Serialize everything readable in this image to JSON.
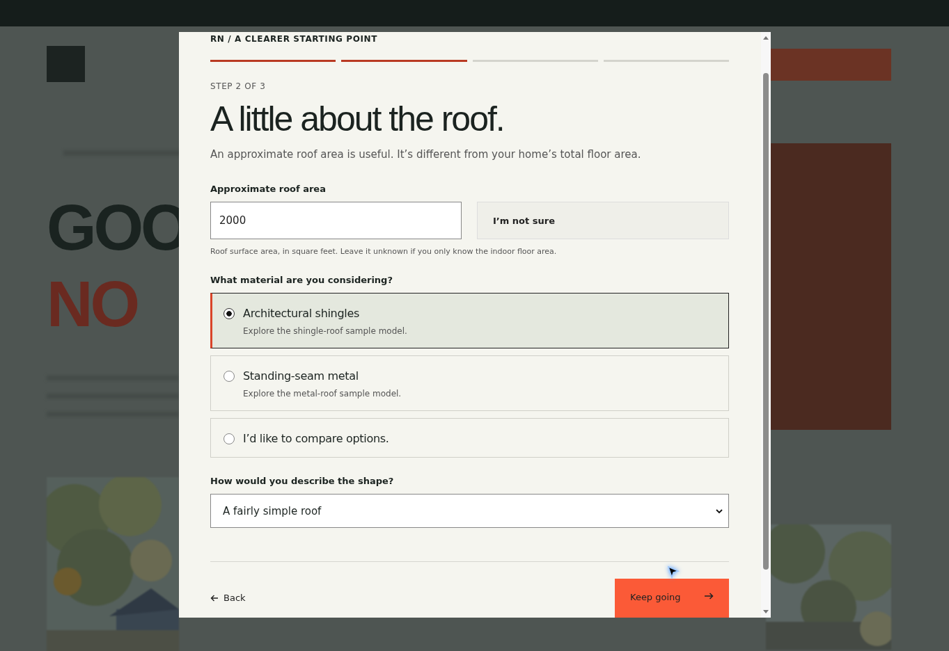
{
  "background": {
    "headline": [
      {
        "text": "GOO",
        "kind": "dark"
      },
      {
        "text": "NO",
        "kind": "accent"
      }
    ]
  },
  "modal": {
    "eyebrow": "RN / A CLEARER STARTING POINT",
    "progress": [
      {
        "done": true
      },
      {
        "done": true
      },
      {
        "done": false
      },
      {
        "done": false
      }
    ],
    "step": "STEP 2 OF 3",
    "title": "A little about the roof.",
    "intro": "An approximate roof area is useful. It’s different from your home’s total floor area.",
    "area": {
      "label": "Approximate roof area",
      "value": "2000",
      "alt_button": "I’m not sure",
      "hint": "Roof surface area, in square feet. Leave it unknown if you only know the indoor floor area."
    },
    "material": {
      "label": "What material are you considering?",
      "options": [
        {
          "title": "Architectural shingles",
          "description": "Explore the shingle-roof sample model.",
          "selected": true
        },
        {
          "title": "Standing-seam metal",
          "description": "Explore the metal-roof sample model.",
          "selected": false
        },
        {
          "title": "I’d like to compare options.",
          "selected": false
        }
      ]
    },
    "shape": {
      "label": "How would you describe the shape?",
      "value": "A fairly simple roof"
    },
    "back": "Back",
    "next": "Keep going"
  }
}
